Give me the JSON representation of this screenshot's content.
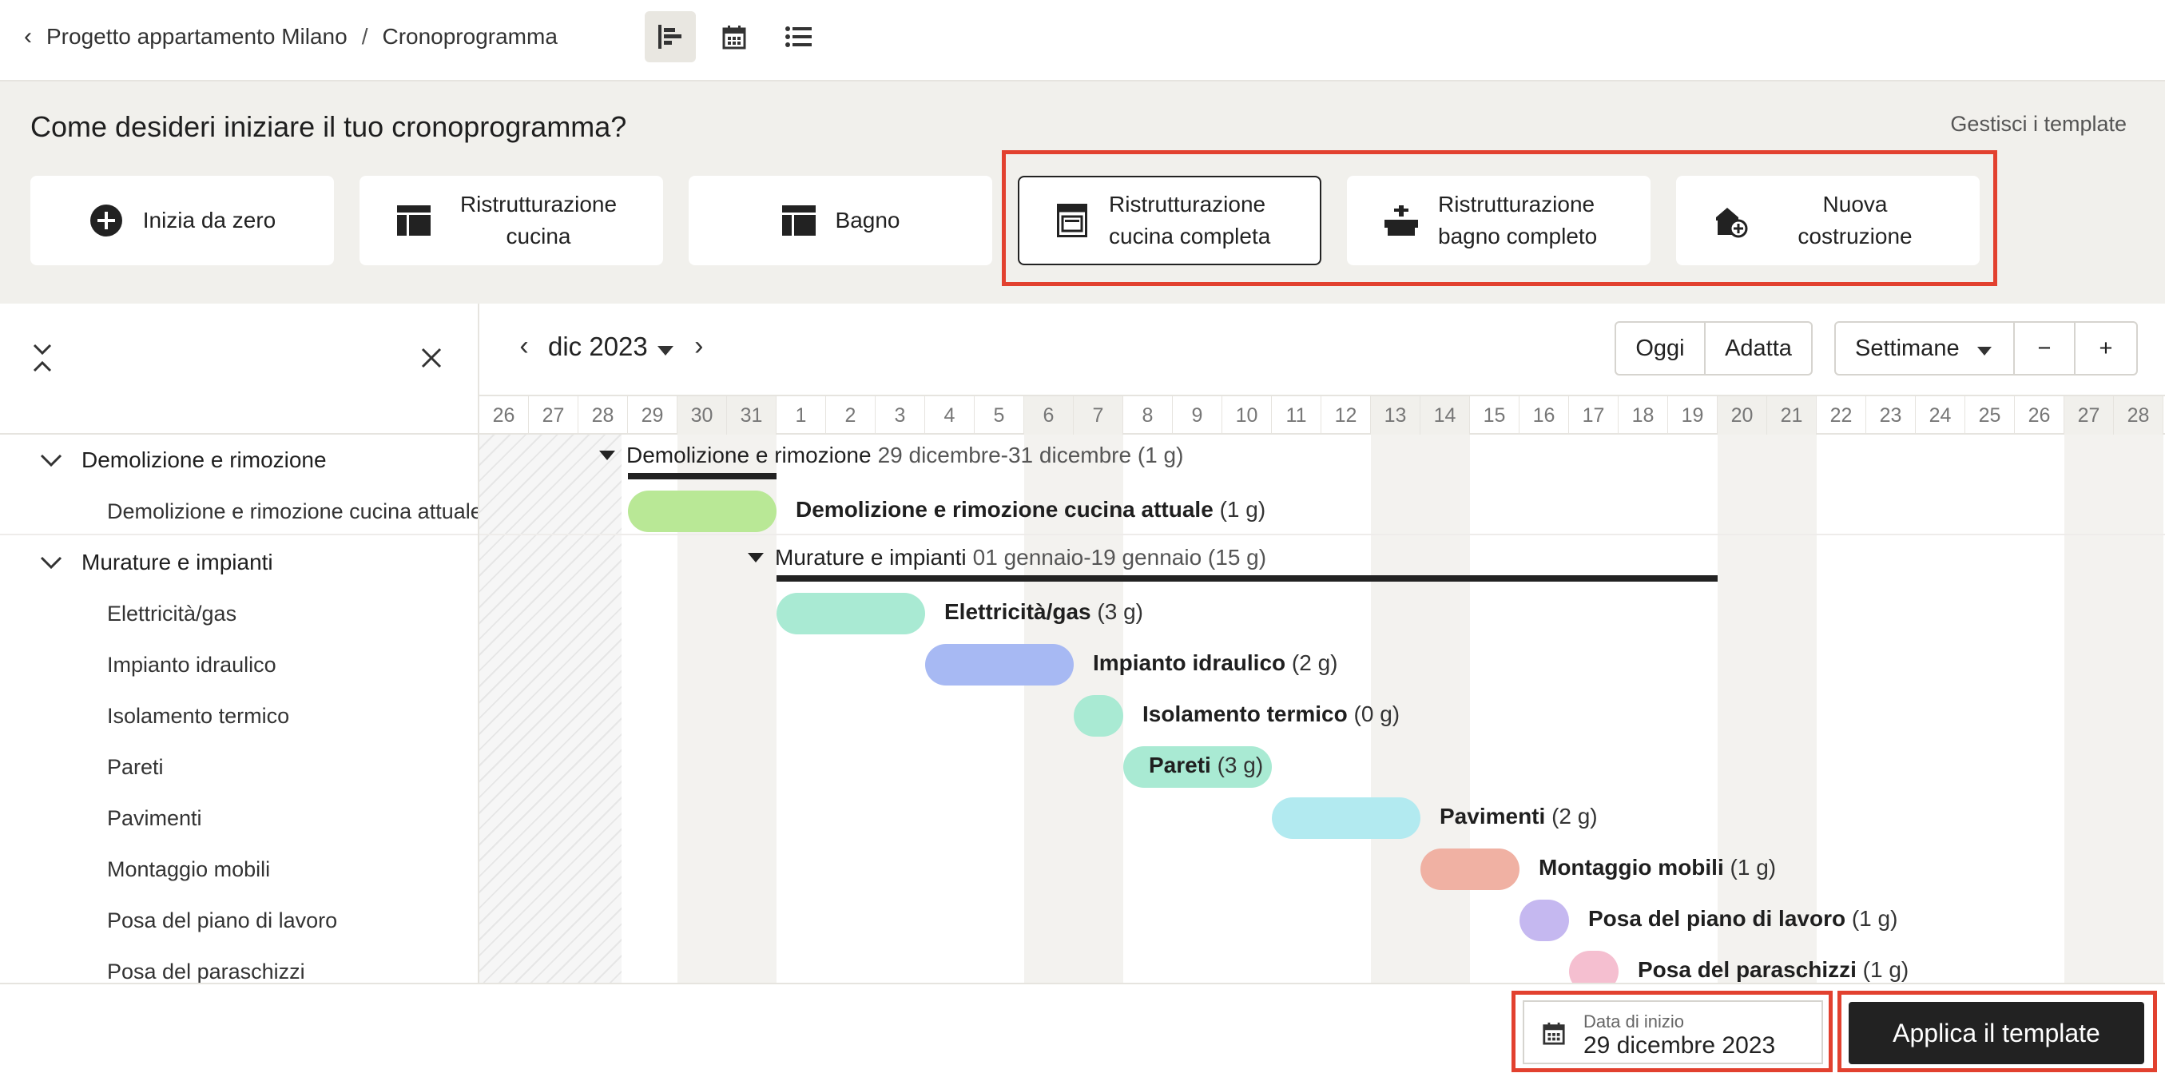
{
  "breadcrumb": {
    "project": "Progetto appartamento Milano",
    "separator": "/",
    "page": "Cronoprogramma"
  },
  "view_icons": [
    "gantt-icon",
    "calendar-icon",
    "list-icon"
  ],
  "templates": {
    "title": "Come desideri iniziare il tuo cronoprogramma?",
    "manage_label": "Gestisci i template",
    "cards": [
      {
        "label": "Inizia da zero",
        "icon": "plus-circle-icon"
      },
      {
        "label": "Ristrutturazione cucina",
        "icon": "layout-icon"
      },
      {
        "label": "Bagno",
        "icon": "layout-icon"
      },
      {
        "label": "Ristrutturazione cucina completa",
        "icon": "oven-icon",
        "selected": true
      },
      {
        "label": "Ristrutturazione bagno completo",
        "icon": "sink-icon"
      },
      {
        "label": "Nuova costruzione",
        "icon": "house-plus-icon"
      }
    ]
  },
  "task_list": {
    "groups": [
      {
        "name": "Demolizione e rimozione",
        "tasks": [
          "Demolizione e rimozione cucina attuale"
        ]
      },
      {
        "name": "Murature e impianti",
        "tasks": [
          "Elettricità/gas",
          "Impianto idraulico",
          "Isolamento termico",
          "Pareti",
          "Pavimenti",
          "Montaggio mobili",
          "Posa del piano di lavoro",
          "Posa del paraschizzi"
        ]
      }
    ]
  },
  "gantt": {
    "month_label": "dic 2023",
    "today_label": "Oggi",
    "fit_label": "Adatta",
    "scale_label": "Settimane",
    "zoom_out": "−",
    "zoom_in": "+",
    "days": [
      "26",
      "27",
      "28",
      "29",
      "30",
      "31",
      "1",
      "2",
      "3",
      "4",
      "5",
      "6",
      "7",
      "8",
      "9",
      "10",
      "11",
      "12",
      "13",
      "14",
      "15",
      "16",
      "17",
      "18",
      "19",
      "20",
      "21",
      "22",
      "23",
      "24",
      "25",
      "26",
      "27",
      "28"
    ],
    "weekend_day_index": [
      4,
      5,
      11,
      12,
      18,
      19,
      25,
      26,
      32,
      33
    ],
    "groups": [
      {
        "name": "Demolizione e rimozione",
        "range": "29 dicembre-31 dicembre (1 g)",
        "start": 3,
        "end": 6
      },
      {
        "name": "Murature e impianti",
        "range": "01 gennaio-19 gennaio (15 g)",
        "start": 6,
        "end": 25
      }
    ],
    "bars": [
      {
        "name": "Demolizione e rimozione cucina attuale",
        "duration": "(1 g)",
        "start": 3,
        "end": 6,
        "color": "#b9e896"
      },
      {
        "name": "Elettricità/gas",
        "duration": "(3 g)",
        "start": 6,
        "end": 9,
        "color": "#a9ead3"
      },
      {
        "name": "Impianto idraulico",
        "duration": "(2 g)",
        "start": 9,
        "end": 12,
        "color": "#a7b9f3"
      },
      {
        "name": "Isolamento termico",
        "duration": "(0 g)",
        "start": 12,
        "end": 13,
        "color": "#a9ead3"
      },
      {
        "name": "Pareti",
        "duration": "(3 g)",
        "start": 13,
        "end": 16,
        "color": "#a9ead3",
        "inside": true
      },
      {
        "name": "Pavimenti",
        "duration": "(2 g)",
        "start": 16,
        "end": 19,
        "color": "#b2eaf0"
      },
      {
        "name": "Montaggio mobili",
        "duration": "(1 g)",
        "start": 19,
        "end": 21,
        "color": "#f0b1a3"
      },
      {
        "name": "Posa del piano di lavoro",
        "duration": "(1 g)",
        "start": 21,
        "end": 22,
        "color": "#c5b8f0"
      },
      {
        "name": "Posa del paraschizzi",
        "duration": "(1 g)",
        "start": 22,
        "end": 23,
        "color": "#f5bfd0"
      }
    ]
  },
  "footer": {
    "start_date_label": "Data di inizio",
    "start_date_value": "29 dicembre 2023",
    "apply_label": "Applica il template"
  },
  "colors": {
    "highlight": "#e2412f",
    "primary": "#222222",
    "panel_bg": "#f1f0ec"
  }
}
